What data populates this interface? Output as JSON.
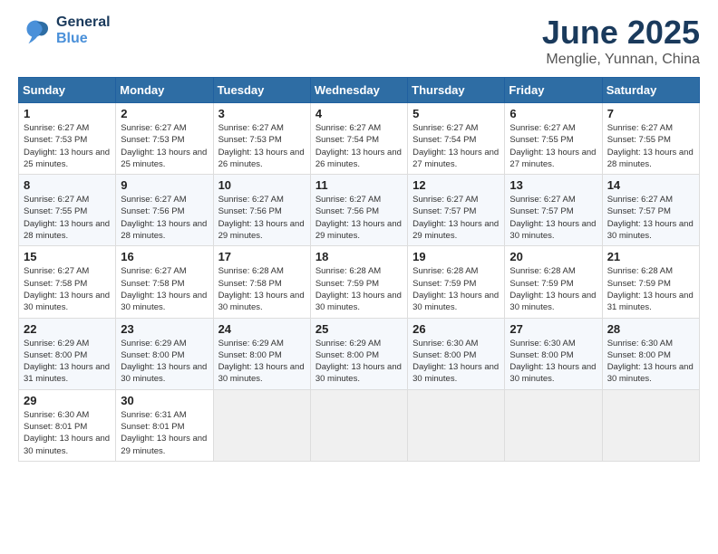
{
  "header": {
    "logo_general": "General",
    "logo_blue": "Blue",
    "title": "June 2025",
    "subtitle": "Menglie, Yunnan, China"
  },
  "calendar": {
    "headers": [
      "Sunday",
      "Monday",
      "Tuesday",
      "Wednesday",
      "Thursday",
      "Friday",
      "Saturday"
    ],
    "weeks": [
      [
        {
          "day": "",
          "empty": true
        },
        {
          "day": "",
          "empty": true
        },
        {
          "day": "",
          "empty": true
        },
        {
          "day": "",
          "empty": true
        },
        {
          "day": "",
          "empty": true
        },
        {
          "day": "",
          "empty": true
        },
        {
          "day": "",
          "empty": true
        }
      ],
      [
        {
          "day": "1",
          "sunrise": "6:27 AM",
          "sunset": "7:53 PM",
          "daylight": "13 hours and 25 minutes."
        },
        {
          "day": "2",
          "sunrise": "6:27 AM",
          "sunset": "7:53 PM",
          "daylight": "13 hours and 25 minutes."
        },
        {
          "day": "3",
          "sunrise": "6:27 AM",
          "sunset": "7:53 PM",
          "daylight": "13 hours and 26 minutes."
        },
        {
          "day": "4",
          "sunrise": "6:27 AM",
          "sunset": "7:54 PM",
          "daylight": "13 hours and 26 minutes."
        },
        {
          "day": "5",
          "sunrise": "6:27 AM",
          "sunset": "7:54 PM",
          "daylight": "13 hours and 27 minutes."
        },
        {
          "day": "6",
          "sunrise": "6:27 AM",
          "sunset": "7:55 PM",
          "daylight": "13 hours and 27 minutes."
        },
        {
          "day": "7",
          "sunrise": "6:27 AM",
          "sunset": "7:55 PM",
          "daylight": "13 hours and 28 minutes."
        }
      ],
      [
        {
          "day": "8",
          "sunrise": "6:27 AM",
          "sunset": "7:55 PM",
          "daylight": "13 hours and 28 minutes."
        },
        {
          "day": "9",
          "sunrise": "6:27 AM",
          "sunset": "7:56 PM",
          "daylight": "13 hours and 28 minutes."
        },
        {
          "day": "10",
          "sunrise": "6:27 AM",
          "sunset": "7:56 PM",
          "daylight": "13 hours and 29 minutes."
        },
        {
          "day": "11",
          "sunrise": "6:27 AM",
          "sunset": "7:56 PM",
          "daylight": "13 hours and 29 minutes."
        },
        {
          "day": "12",
          "sunrise": "6:27 AM",
          "sunset": "7:57 PM",
          "daylight": "13 hours and 29 minutes."
        },
        {
          "day": "13",
          "sunrise": "6:27 AM",
          "sunset": "7:57 PM",
          "daylight": "13 hours and 30 minutes."
        },
        {
          "day": "14",
          "sunrise": "6:27 AM",
          "sunset": "7:57 PM",
          "daylight": "13 hours and 30 minutes."
        }
      ],
      [
        {
          "day": "15",
          "sunrise": "6:27 AM",
          "sunset": "7:58 PM",
          "daylight": "13 hours and 30 minutes."
        },
        {
          "day": "16",
          "sunrise": "6:27 AM",
          "sunset": "7:58 PM",
          "daylight": "13 hours and 30 minutes."
        },
        {
          "day": "17",
          "sunrise": "6:28 AM",
          "sunset": "7:58 PM",
          "daylight": "13 hours and 30 minutes."
        },
        {
          "day": "18",
          "sunrise": "6:28 AM",
          "sunset": "7:59 PM",
          "daylight": "13 hours and 30 minutes."
        },
        {
          "day": "19",
          "sunrise": "6:28 AM",
          "sunset": "7:59 PM",
          "daylight": "13 hours and 30 minutes."
        },
        {
          "day": "20",
          "sunrise": "6:28 AM",
          "sunset": "7:59 PM",
          "daylight": "13 hours and 30 minutes."
        },
        {
          "day": "21",
          "sunrise": "6:28 AM",
          "sunset": "7:59 PM",
          "daylight": "13 hours and 31 minutes."
        }
      ],
      [
        {
          "day": "22",
          "sunrise": "6:29 AM",
          "sunset": "8:00 PM",
          "daylight": "13 hours and 31 minutes."
        },
        {
          "day": "23",
          "sunrise": "6:29 AM",
          "sunset": "8:00 PM",
          "daylight": "13 hours and 30 minutes."
        },
        {
          "day": "24",
          "sunrise": "6:29 AM",
          "sunset": "8:00 PM",
          "daylight": "13 hours and 30 minutes."
        },
        {
          "day": "25",
          "sunrise": "6:29 AM",
          "sunset": "8:00 PM",
          "daylight": "13 hours and 30 minutes."
        },
        {
          "day": "26",
          "sunrise": "6:30 AM",
          "sunset": "8:00 PM",
          "daylight": "13 hours and 30 minutes."
        },
        {
          "day": "27",
          "sunrise": "6:30 AM",
          "sunset": "8:00 PM",
          "daylight": "13 hours and 30 minutes."
        },
        {
          "day": "28",
          "sunrise": "6:30 AM",
          "sunset": "8:00 PM",
          "daylight": "13 hours and 30 minutes."
        }
      ],
      [
        {
          "day": "29",
          "sunrise": "6:30 AM",
          "sunset": "8:01 PM",
          "daylight": "13 hours and 30 minutes."
        },
        {
          "day": "30",
          "sunrise": "6:31 AM",
          "sunset": "8:01 PM",
          "daylight": "13 hours and 29 minutes."
        },
        {
          "day": "",
          "empty": true
        },
        {
          "day": "",
          "empty": true
        },
        {
          "day": "",
          "empty": true
        },
        {
          "day": "",
          "empty": true
        },
        {
          "day": "",
          "empty": true
        }
      ]
    ]
  },
  "labels": {
    "sunrise": "Sunrise:",
    "sunset": "Sunset:",
    "daylight": "Daylight:"
  }
}
